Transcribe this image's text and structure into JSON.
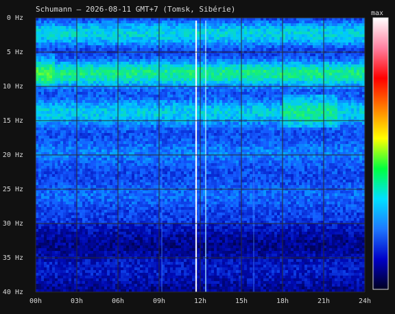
{
  "chart_data": {
    "type": "heatmap",
    "title": "Schumann – 2026-08-11 GMT+7  (Tomsk, Sibérie)",
    "x_ticks": [
      "00h",
      "03h",
      "06h",
      "09h",
      "12h",
      "15h",
      "18h",
      "21h",
      "24h"
    ],
    "y_ticks": [
      "0 Hz",
      "5 Hz",
      "10 Hz",
      "15 Hz",
      "20 Hz",
      "25 Hz",
      "30 Hz",
      "35 Hz",
      "40 Hz"
    ],
    "xlim_hours": [
      0,
      24
    ],
    "ylim_hz": [
      0,
      40
    ],
    "grid": true,
    "colorbar": {
      "label": "max",
      "colors": [
        "#000020",
        "#0000c8",
        "#1e78ff",
        "#00e0ff",
        "#00ff40",
        "#ffff00",
        "#ff8000",
        "#ff0000",
        "#ff80a0",
        "#ffffff"
      ]
    },
    "bands": [
      {
        "freq_hz": 2.5,
        "intensity": 0.55
      },
      {
        "freq_hz": 8,
        "intensity": 0.75
      },
      {
        "freq_hz": 13.5,
        "intensity": 0.62
      },
      {
        "freq_hz": 19.5,
        "intensity": 0.42
      },
      {
        "freq_hz": 26,
        "intensity": 0.36
      }
    ],
    "spike_time_h": [
      11.7,
      12.4,
      9.2,
      15.9
    ]
  }
}
